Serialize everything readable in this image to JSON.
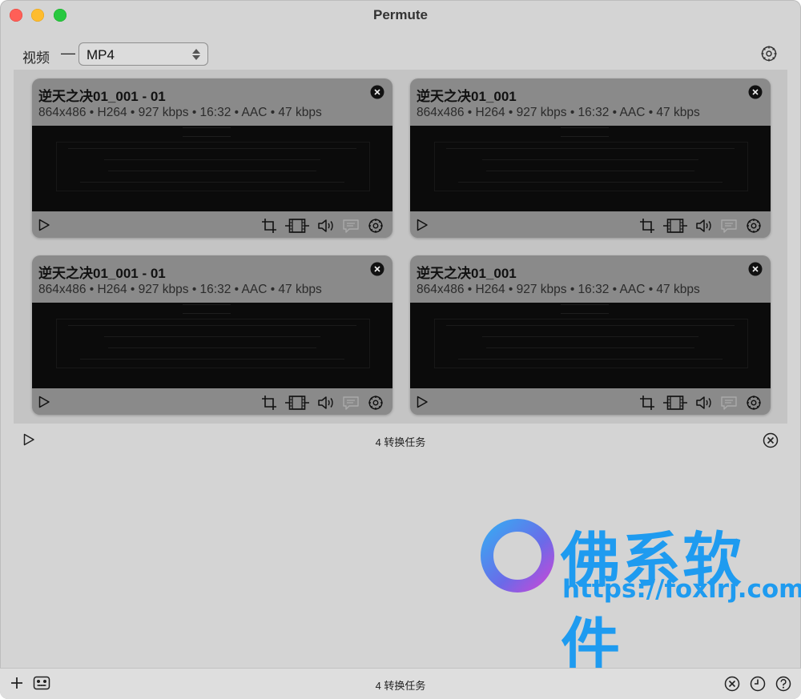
{
  "window": {
    "title": "Permute"
  },
  "toolbar": {
    "category_label": "视频",
    "dash": "—",
    "format_value": "MP4",
    "icons": {
      "arrows": "select-updown-icon",
      "settings": "gear-icon"
    }
  },
  "items": [
    {
      "title": "逆天之决01_001 - 01",
      "meta": "864x486 • H264 • 927 kbps • 16:32 • AAC • 47 kbps"
    },
    {
      "title": "逆天之决01_001",
      "meta": "864x486 • H264 • 927 kbps • 16:32 • AAC • 47 kbps"
    },
    {
      "title": "逆天之决01_001 - 01",
      "meta": "864x486 • H264 • 927 kbps • 16:32 • AAC • 47 kbps"
    },
    {
      "title": "逆天之决01_001",
      "meta": "864x486 • H264 • 927 kbps • 16:32 • AAC • 47 kbps"
    }
  ],
  "queue": {
    "status": "4 转换任务"
  },
  "watermark": {
    "brand": "佛系软件",
    "url": "https://foxirj.com"
  },
  "bottombar": {
    "status": "4 转换任务"
  },
  "colors": {
    "accent": "#1e9bf0",
    "card": "#8a8a8a",
    "queue_bg": "#c4c4c4"
  }
}
